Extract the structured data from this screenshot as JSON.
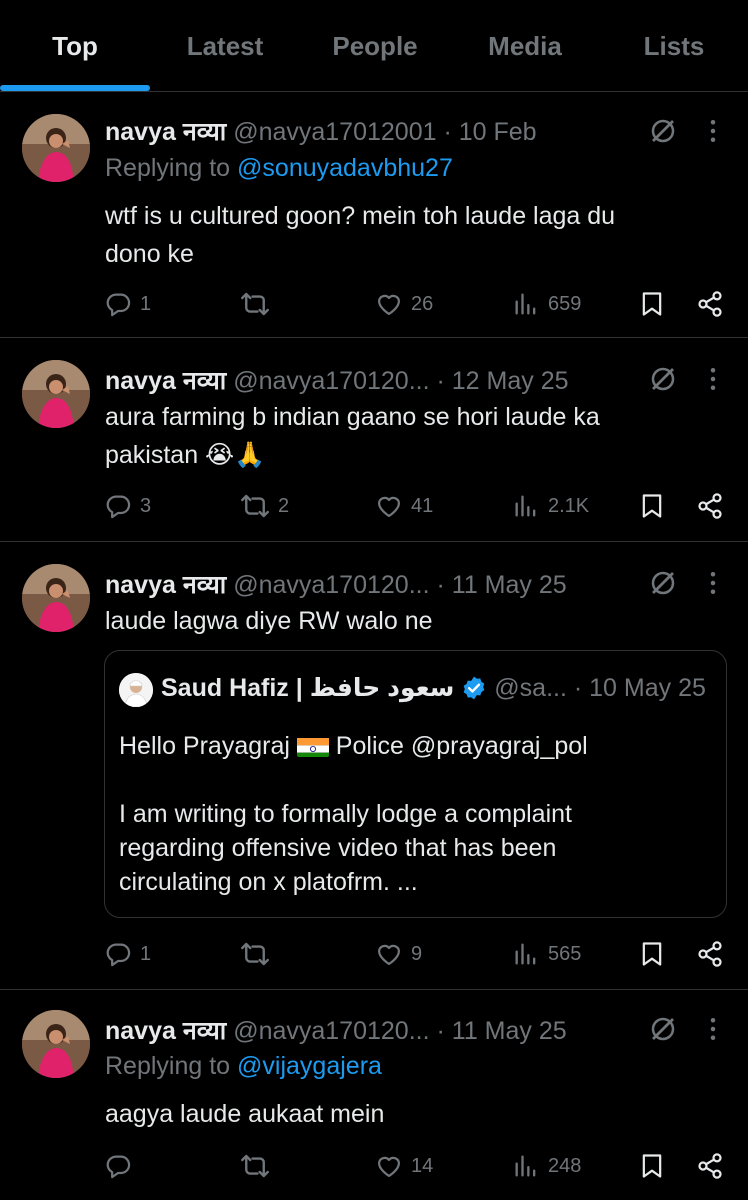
{
  "tabs": [
    {
      "label": "Top",
      "active": true
    },
    {
      "label": "Latest",
      "active": false
    },
    {
      "label": "People",
      "active": false
    },
    {
      "label": "Media",
      "active": false
    },
    {
      "label": "Lists",
      "active": false
    }
  ],
  "colors": {
    "accent": "#1d9bf0",
    "muted": "#71767b",
    "text": "#e7e9ea",
    "border": "#2f3336",
    "background": "#000000"
  },
  "icons": [
    "reply-icon",
    "repost-icon",
    "like-icon",
    "views-icon",
    "bookmark-icon",
    "share-icon",
    "grok-icon",
    "more-icon",
    "verified-icon"
  ],
  "posts": [
    {
      "name": "navya नव्या",
      "handle": "@navya17012001",
      "date": "· 10 Feb",
      "replying_label": "Replying to ",
      "replying_to": "@sonuyadavbhu27",
      "text_lines": [
        "wtf is u cultured goon? mein toh laude laga du",
        "dono ke"
      ],
      "replies": "1",
      "reposts": "",
      "likes": "26",
      "views": "659"
    },
    {
      "name": "navya नव्या",
      "handle": "@navya170120...",
      "date": "· 12 May 25",
      "text_lines": [
        "aura farming b indian gaano se hori laude ka",
        "pakistan 😭🙏"
      ],
      "replies": "3",
      "reposts": "2",
      "likes": "41",
      "views": "2.1K"
    },
    {
      "name": "navya नव्या",
      "handle": "@navya170120...",
      "date": "· 11 May 25",
      "text_lines": [
        "laude lagwa diye RW walo ne"
      ],
      "quote": {
        "name": "Saud Hafiz | سعود حافظ",
        "handle": "@sa...",
        "date": "· 10 May 25",
        "line1_a": "Hello Prayagraj ",
        "line1_b": " Police @prayagraj_pol",
        "body_lines": [
          "I am writing to formally lodge a complaint",
          "regarding offensive video that has been",
          "circulating on x platofrm. ..."
        ]
      },
      "replies": "1",
      "reposts": "",
      "likes": "9",
      "views": "565"
    },
    {
      "name": "navya नव्या",
      "handle": "@navya170120...",
      "date": "· 11 May 25",
      "replying_label": "Replying to ",
      "replying_to": "@vijaygajera",
      "text_lines": [
        "aagya laude aukaat mein"
      ],
      "replies": "",
      "reposts": "",
      "likes": "14",
      "views": "248"
    }
  ]
}
